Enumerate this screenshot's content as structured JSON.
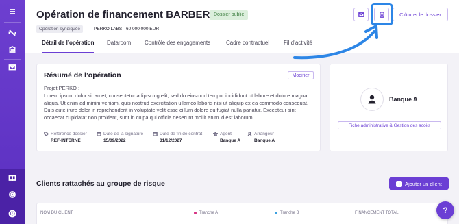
{
  "sidebar": {
    "icons": [
      "menu-icon",
      "clients-icon",
      "bank-icon",
      "mail-icon",
      "book-icon",
      "settings-icon",
      "user-circle-icon"
    ]
  },
  "header": {
    "title": "Opération de financement BARBERA",
    "status_badge": "Dossier publié",
    "tag": "Opération syndiquée",
    "amount_line": "PERKO LABS · 60 000 000 EUR",
    "close_button": "Clôturer le dossier",
    "highlight_color": "#2d86e6"
  },
  "tabs": [
    {
      "label": "Détail de l’opération",
      "active": true
    },
    {
      "label": "Dataroom",
      "active": false
    },
    {
      "label": "Contrôle des engagements",
      "active": false
    },
    {
      "label": "Cadre contractuel",
      "active": false
    },
    {
      "label": "Fil d’activité",
      "active": false
    }
  ],
  "summary": {
    "title": "Résumé de l’opération",
    "modify_button": "Modifier",
    "project_label": "Projet PERKO :",
    "description": "Lorem ipsum dolor sit amet, consectetur adipiscing elit, sed do eiusmod tempor incididunt ut labore et dolore magna aliqua. Ut enim ad minim veniam, quis nostrud exercitation ullamco laboris nisi ut aliquip ex ea commodo consequat. Duis aute irure dolor in reprehenderit in voluptate velit esse cillum dolore eu fugiat nulla pariatur. Excepteur sint occaecat cupidatat non proident, sunt in culpa qui officia deserunt mollit anim id est laborum",
    "facts": [
      {
        "icon": "tag-icon",
        "label": "Référence dossier",
        "value": "REF-INTERNE"
      },
      {
        "icon": "calendar-icon",
        "label": "Date de la signature",
        "value": "15/09/2022"
      },
      {
        "icon": "calendar-icon",
        "label": "Date de fin de contrat",
        "value": "31/12/2027"
      },
      {
        "icon": "star-icon",
        "label": "Agent",
        "value": "Banque A"
      },
      {
        "icon": "person-icon",
        "label": "Arrangeur",
        "value": "Banque A"
      }
    ]
  },
  "bank_card": {
    "name": "Banque A",
    "button": "Fiche administrative & Gestion des accès"
  },
  "clients": {
    "title": "Clients rattachés au groupe de risque",
    "add_button": "Ajouter un client",
    "columns": [
      {
        "label": "NOM DU CLIENT"
      },
      {
        "label": "Tranche A",
        "dot_color": "#d63384"
      },
      {
        "label": "Tranche B",
        "dot_color": "#3aa0e0"
      },
      {
        "label": "FINANCEMENT TOTAL"
      }
    ]
  },
  "help_button": "?"
}
